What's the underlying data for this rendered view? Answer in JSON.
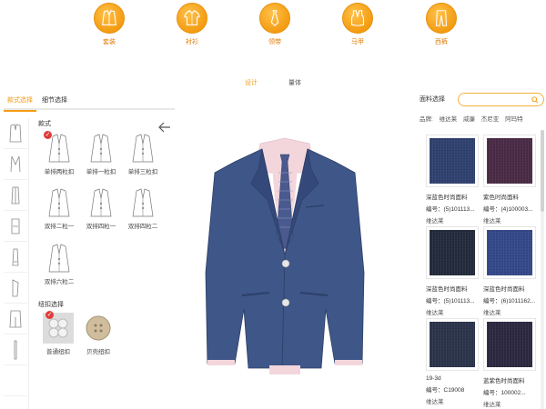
{
  "categories": [
    {
      "label": "套装",
      "icon": "suit-icon"
    },
    {
      "label": "衬衫",
      "icon": "shirt-icon"
    },
    {
      "label": "领带",
      "icon": "tie-icon"
    },
    {
      "label": "马甲",
      "icon": "vest-icon"
    },
    {
      "label": "西裤",
      "icon": "trousers-icon"
    }
  ],
  "mode_tabs": {
    "design": "设计",
    "measure": "量体"
  },
  "left_tabs": {
    "style": "款式选择",
    "detail": "细节选择"
  },
  "sections": {
    "style": "款式",
    "button": "纽扣选择"
  },
  "styles": [
    {
      "label": "单排两粒扣",
      "selected": true
    },
    {
      "label": "单排一粒扣",
      "selected": false
    },
    {
      "label": "单排三粒扣",
      "selected": false
    },
    {
      "label": "双排二粒一",
      "selected": false
    },
    {
      "label": "双排四粒一",
      "selected": false
    },
    {
      "label": "双排四粒二",
      "selected": false
    },
    {
      "label": "双排六粒二",
      "selected": false
    }
  ],
  "buttons": [
    {
      "label": "普通纽扣",
      "selected": true,
      "color": "#cfcfcf"
    },
    {
      "label": "贝壳纽扣",
      "selected": false,
      "color": "#c7b69a"
    }
  ],
  "fabric": {
    "search_label": "面料选择",
    "search_placeholder": "",
    "brands": [
      "品牌:",
      "维达莱",
      "威廉",
      "杰尼亚",
      "阿玛特"
    ],
    "items": [
      {
        "name": "深蓝色时尚面料",
        "code": "编号：(5)101113...",
        "brand": "维达莱",
        "color": "#2f4170"
      },
      {
        "name": "紫色时尚面料",
        "code": "编号：(4)100003...",
        "brand": "维达莱",
        "color": "#4a2a45"
      },
      {
        "name": "深蓝色时尚面料",
        "code": "编号：(5)101113...",
        "brand": "维达莱",
        "color": "#232b3c"
      },
      {
        "name": "深蓝色时尚面料",
        "code": "编号：(6)1011162...",
        "brand": "维达莱",
        "color": "#34488a"
      },
      {
        "name": "19-3d",
        "code": "编号：C19008",
        "brand": "维达莱",
        "color": "#2b344b"
      },
      {
        "name": "蓝紫色时尚面料",
        "code": "编号：100002...",
        "brand": "维达莱",
        "color": "#2c2840"
      }
    ]
  },
  "colors": {
    "accent": "#f39c12",
    "suit": "#3e5688",
    "shirt": "#f3d6dc",
    "tie": "#4a5a8e"
  }
}
